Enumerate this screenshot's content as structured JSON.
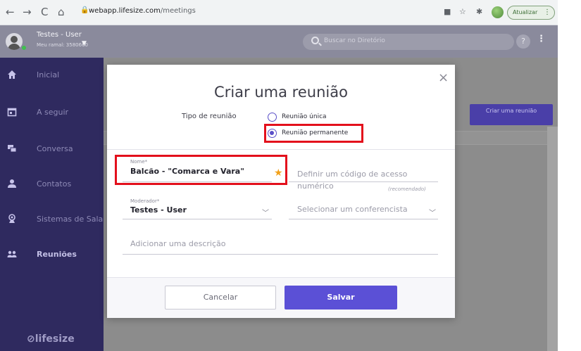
{
  "browser": {
    "back": "←",
    "forward": "→",
    "reload": "C",
    "home": "⌂",
    "url_host": "webapp.lifesize.com",
    "url_path": "/meetings",
    "update_label": "Atualizar",
    "update_menu": "⋮"
  },
  "appbar": {
    "user_name": "Testes - User",
    "user_extension": "Meu ramal: 3580660",
    "search_placeholder": "Buscar no Diretório",
    "help": "?",
    "menu": "⋮"
  },
  "sidebar": {
    "items": [
      {
        "label": "Inicial",
        "icon": "home-icon"
      },
      {
        "label": "A seguir",
        "icon": "calendar-icon"
      },
      {
        "label": "Conversa",
        "icon": "chat-icon"
      },
      {
        "label": "Contatos",
        "icon": "contact-icon"
      },
      {
        "label": "Sistemas de Sala",
        "icon": "room-system-icon"
      },
      {
        "label": "Reuniões",
        "icon": "meetings-icon"
      }
    ],
    "logo": "lifesize"
  },
  "main": {
    "create_button": "Criar uma reunião"
  },
  "modal": {
    "title": "Criar uma reunião",
    "close": "×",
    "meeting_type_label": "Tipo de reunião",
    "option_single": "Reunião única",
    "option_permanent": "Reunião permanente",
    "selected_option": "Reunião permanente",
    "name_label": "Nome*",
    "name_value": "Balcão - \"Comarca e Vara\"",
    "passcode_placeholder": "Definir um código de acesso numérico",
    "passcode_hint": "(recomendado)",
    "moderator_label": "Moderador*",
    "moderator_value": "Testes - User",
    "presenter_placeholder": "Selecionar um conferencista",
    "description_placeholder": "Adicionar uma descrição",
    "cancel_label": "Cancelar",
    "save_label": "Salvar"
  },
  "colors": {
    "sidebar": "#2f2a5f",
    "accent": "#5b50d6",
    "highlight": "#e3101c",
    "star": "#f2a11a"
  }
}
